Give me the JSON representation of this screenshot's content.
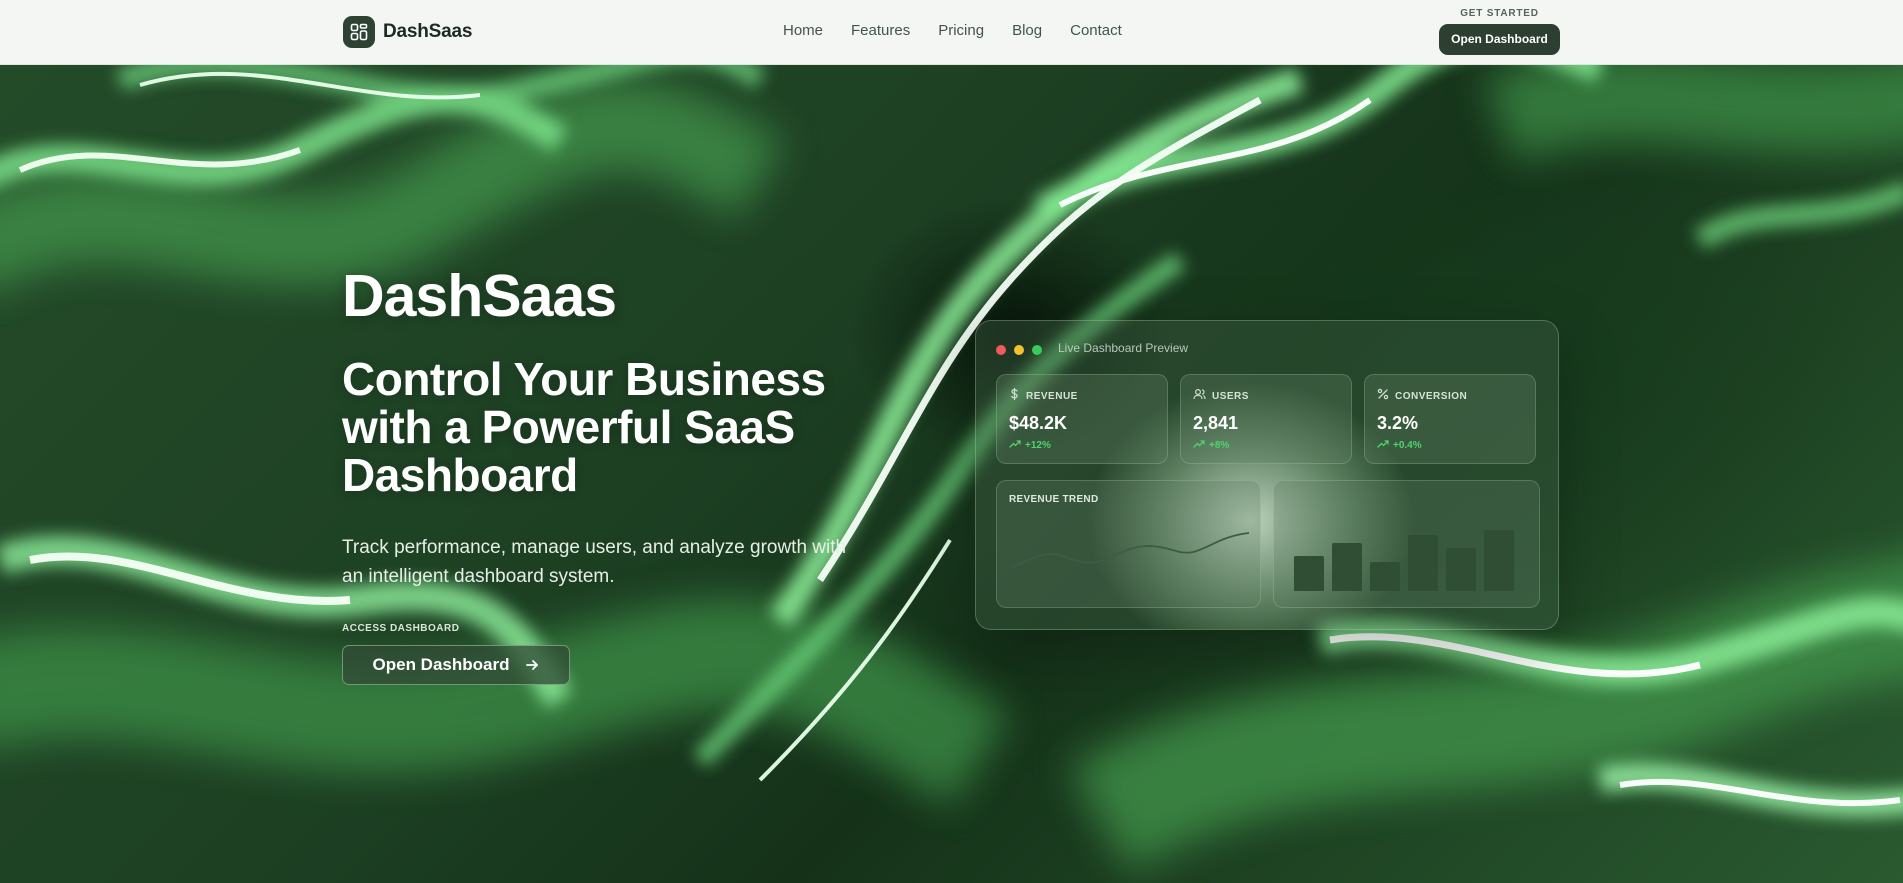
{
  "nav": {
    "brand": "DashSaas",
    "logo_icon": "grid-icon",
    "links": [
      "Home",
      "Features",
      "Pricing",
      "Blog",
      "Contact"
    ],
    "cta_label": "GET STARTED",
    "cta_button": "Open Dashboard"
  },
  "hero": {
    "title": "DashSaas",
    "heading": "Control Your Business with a Powerful SaaS Dashboard",
    "subheading": "Track performance, manage users, and analyze growth with an intelligent dashboard system.",
    "access_label": "ACCESS DASHBOARD",
    "button": "Open Dashboard",
    "button_icon": "arrow-right-icon"
  },
  "preview": {
    "title": "Live Dashboard Preview",
    "window_dot_colors": [
      "#ef5b5b",
      "#f2c12e",
      "#3ccb5a"
    ],
    "stats": [
      {
        "icon": "dollar-icon",
        "label": "REVENUE",
        "value": "$48.2K",
        "change": "+12%"
      },
      {
        "icon": "users-icon",
        "label": "USERS",
        "value": "2,841",
        "change": "+8%"
      },
      {
        "icon": "percent-icon",
        "label": "CONVERSION",
        "value": "3.2%",
        "change": "+0.4%"
      }
    ],
    "revenue_trend_label": "REVENUE TREND",
    "bar_chart": {
      "type": "bar",
      "values": [
        0.55,
        0.75,
        0.45,
        0.88,
        0.67,
        0.95
      ]
    }
  },
  "colors": {
    "accent_dark": "#2c3f31",
    "positive_green": "#4fd46e",
    "nav_background": "#f4f6f3"
  }
}
